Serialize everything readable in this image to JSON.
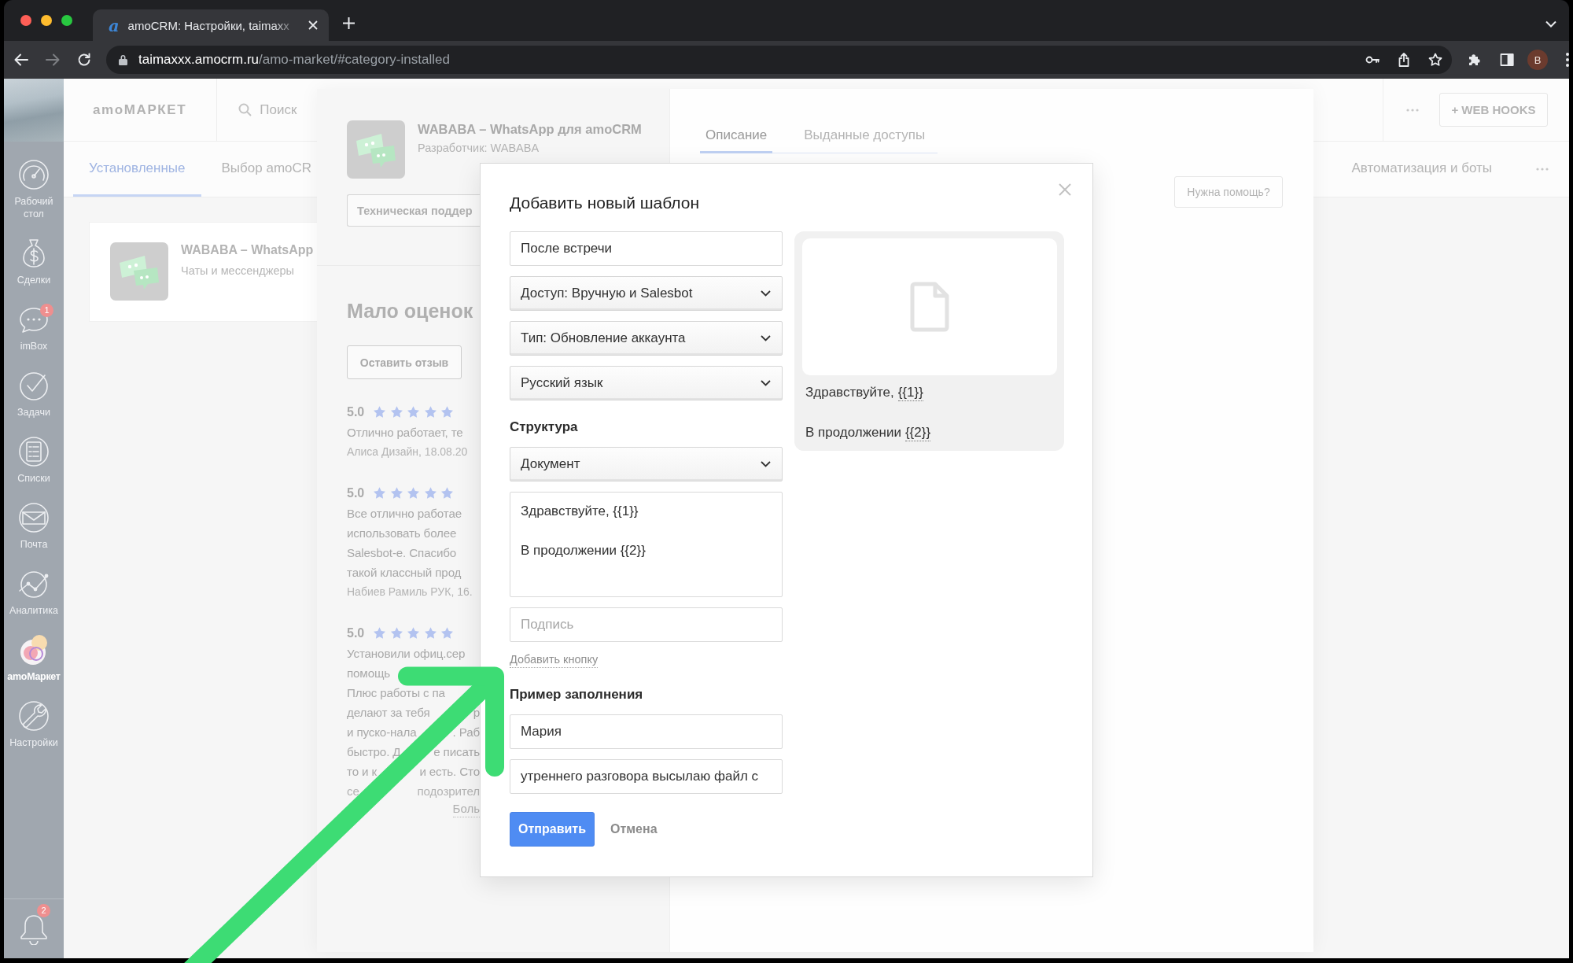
{
  "browser": {
    "tab": {
      "favicon": "a",
      "title": "amoCRM: Настройки, taimaxx"
    },
    "address": {
      "host": "taimaxxx.amocrm.ru",
      "path": "/amo-market/#category-installed"
    },
    "profile": "B"
  },
  "sidebar": {
    "items": [
      {
        "kind": "desk",
        "label": "Рабочий стол",
        "selected": false
      },
      {
        "kind": "deals",
        "label": "Сделки",
        "selected": false
      },
      {
        "kind": "chat",
        "label": "imBox",
        "badge": "1",
        "selected": false
      },
      {
        "kind": "tasks",
        "label": "Задачи",
        "selected": false
      },
      {
        "kind": "lists",
        "label": "Списки",
        "selected": false
      },
      {
        "kind": "mail",
        "label": "Почта",
        "selected": false
      },
      {
        "kind": "analytics",
        "label": "Аналитика",
        "selected": false
      },
      {
        "kind": "market",
        "label": "amoМаркет",
        "selected": true
      },
      {
        "kind": "settings",
        "label": "Настройки",
        "selected": false
      }
    ],
    "notifications": {
      "badge": "2"
    }
  },
  "market": {
    "logo": "amoМАРКЕТ",
    "search": {
      "placeholder": "Поиск"
    },
    "webhooks_button": "+ WEB HOOKS",
    "tabs": [
      {
        "label": "Установленные",
        "selected": true
      },
      {
        "label": "Выбор amoCR",
        "selected": false
      }
    ],
    "right_tabs": [
      {
        "label": "Автоматизация и боты",
        "selected": false
      }
    ],
    "installed": [
      {
        "name": "WABABA – WhatsApp",
        "category": "Чаты и мессенджеры"
      }
    ]
  },
  "app_panel": {
    "name": "WABABA – WhatsApp для amoCRM",
    "developer": "Разработчик: WABABA",
    "support_button": "Техническая поддер",
    "rating_heading": "Мало оценок",
    "review_button": "Оставить отзыв",
    "reviews": [
      {
        "score": "5.0",
        "stars": 5,
        "lines": [
          [
            "Отлично работает, те"
          ]
        ],
        "author": "Алиса Дизайн, 18.08.20"
      },
      {
        "score": "5.0",
        "stars": 5,
        "lines": [
          [
            "Все отлично работае"
          ],
          [
            "использовать более"
          ],
          [
            "Salesbot-е. Спасибо"
          ],
          [
            "такой классный прод"
          ]
        ],
        "author": "Набиев Рамиль РУК, 16."
      },
      {
        "score": "5.0",
        "stars": 5,
        "lines": [
          [
            "Установили офиц.сер"
          ],
          [
            "помощь"
          ],
          [
            "Плюс работы с па"
          ],
          [
            "делают за тебя",
            "р"
          ],
          [
            "и пуско-нала",
            ". Раб"
          ],
          [
            "быстро. Д",
            "е писать"
          ],
          [
            "то и к",
            "и есть. Сто"
          ],
          [
            "се",
            "подозрител"
          ]
        ],
        "more_link": "Боль"
      }
    ],
    "tabs": [
      {
        "label": "Описание",
        "selected": true
      },
      {
        "label": "Выданные доступы",
        "selected": false
      }
    ],
    "help_button": "Нужна помощь?"
  },
  "modal": {
    "title": "Добавить новый шаблон",
    "form": [
      {
        "kind": "input",
        "value": "После встречи"
      },
      {
        "kind": "select",
        "value": "Доступ: Вручную и Salesbot"
      },
      {
        "kind": "select",
        "value": "Тип: Обновление аккаунта"
      },
      {
        "kind": "select",
        "value": "Русский язык"
      },
      {
        "kind": "heading",
        "text": "Структура"
      },
      {
        "kind": "select",
        "value": "Документ"
      },
      {
        "kind": "textarea",
        "value": "Здравствуйте, {{1}}\n\nВ продолжении {{2}}"
      },
      {
        "kind": "input",
        "placeholder": "Подпись"
      },
      {
        "kind": "link",
        "text": "Добавить кнопку"
      },
      {
        "kind": "heading",
        "text": "Пример заполнения"
      },
      {
        "kind": "input",
        "value": "Мария"
      },
      {
        "kind": "input",
        "value": "утреннего разговора высылаю файл с"
      }
    ],
    "submit": "Отправить",
    "cancel": "Отмена",
    "preview": {
      "attachment": {
        "kind": "document"
      },
      "lines": [
        {
          "text": "Здравствуйте,",
          "variable": "{{1}}"
        },
        {
          "text": "В продолжении",
          "variable": "{{2}}"
        }
      ]
    }
  },
  "annotation": {
    "kind": "arrow"
  }
}
